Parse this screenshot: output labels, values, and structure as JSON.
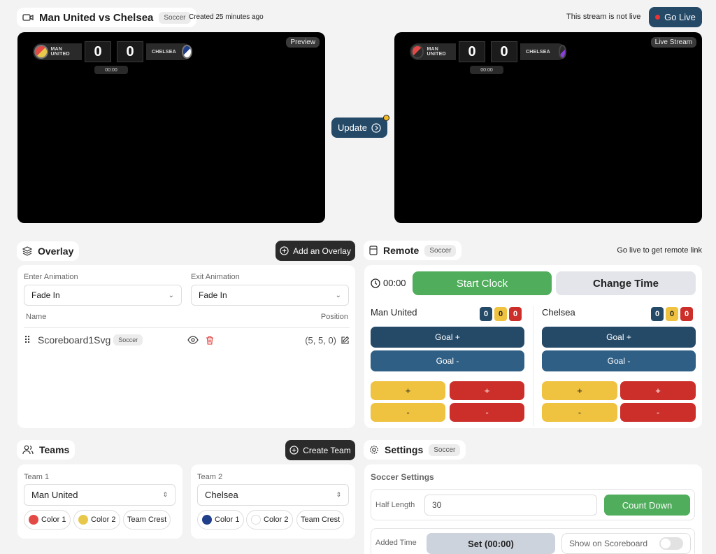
{
  "header": {
    "title": "Man United vs Chelsea",
    "sport_badge": "Soccer",
    "created": "Created 25 minutes ago",
    "live_status": "This stream is not live",
    "go_live_label": "Go Live"
  },
  "preview": {
    "label": "Preview",
    "home_team": "MAN UNITED",
    "away_team": "CHELSEA",
    "home_score": "0",
    "away_score": "0",
    "clock": "00:00"
  },
  "live": {
    "label": "Live Stream",
    "home_team": "MAN UNITED",
    "away_team": "CHELSEA",
    "home_score": "0",
    "away_score": "0",
    "clock": "00:00"
  },
  "update_label": "Update",
  "overlay": {
    "title": "Overlay",
    "add_label": "Add an Overlay",
    "enter_label": "Enter Animation",
    "enter_value": "Fade In",
    "exit_label": "Exit Animation",
    "exit_value": "Fade In",
    "col_name": "Name",
    "col_position": "Position",
    "rows": [
      {
        "name": "Scoreboard1Svg",
        "badge": "Soccer",
        "position": "(5, 5, 0)"
      }
    ]
  },
  "remote": {
    "title": "Remote",
    "badge": "Soccer",
    "link_text": "Go live to get remote link",
    "clock": "00:00",
    "start_clock": "Start Clock",
    "change_time": "Change Time",
    "teams": [
      {
        "name": "Man United",
        "score": "0",
        "yellow": "0",
        "red": "0",
        "goal_plus": "Goal +",
        "goal_minus": "Goal -",
        "plus": "+",
        "minus": "-"
      },
      {
        "name": "Chelsea",
        "score": "0",
        "yellow": "0",
        "red": "0",
        "goal_plus": "Goal +",
        "goal_minus": "Goal -",
        "plus": "+",
        "minus": "-"
      }
    ]
  },
  "teams": {
    "title": "Teams",
    "create_label": "Create Team",
    "list": [
      {
        "label": "Team 1",
        "value": "Man United",
        "color1": "Color 1",
        "color2": "Color 2",
        "crest": "Team Crest",
        "c1": "#e34a45",
        "c2": "#e8c84a"
      },
      {
        "label": "Team 2",
        "value": "Chelsea",
        "color1": "Color 1",
        "color2": "Color 2",
        "crest": "Team Crest",
        "c1": "#1f3f8a",
        "c2": "#ffffff"
      }
    ]
  },
  "settings": {
    "title": "Settings",
    "badge": "Soccer",
    "section": "Soccer Settings",
    "half_label": "Half Length",
    "half_value": "30",
    "count_down": "Count Down",
    "added_label": "Added Time",
    "set_label": "Set (00:00)",
    "show_label": "Show on Scoreboard"
  },
  "colors": {
    "accent_navy": "#254a68",
    "go_live_dot": "#e33",
    "green": "#4fad5b"
  }
}
